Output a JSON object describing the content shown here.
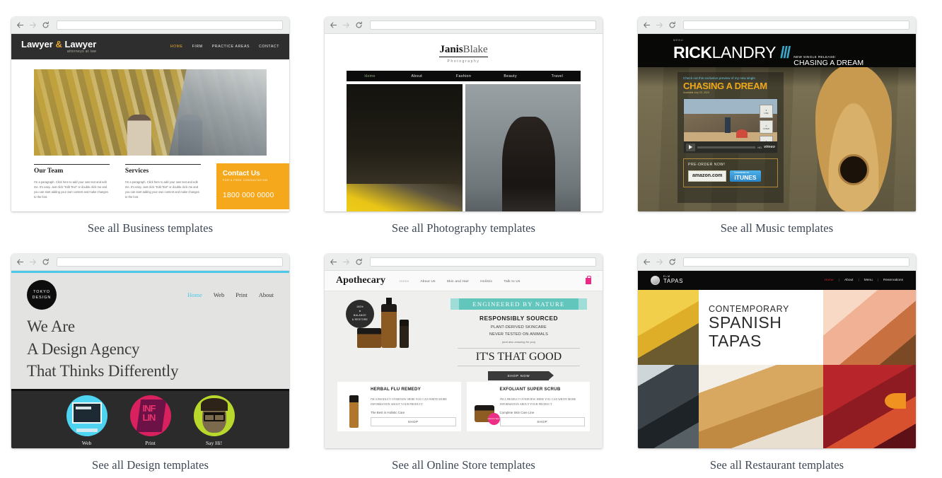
{
  "browser_chrome": {
    "back_icon": "back-arrow-icon",
    "forward_icon": "forward-arrow-icon",
    "reload_icon": "reload-icon",
    "url_value": "",
    "url_placeholder": ""
  },
  "cards": [
    {
      "id": "business",
      "caption": "See all Business templates",
      "site": {
        "logo": "Lawyer",
        "logo_amp": "&",
        "logo_2": "Lawyer",
        "tagline": "attorneys at law",
        "nav": [
          "HOME",
          "FIRM",
          "PRACTICE AREAS",
          "CONTACT"
        ],
        "active_nav": "HOME",
        "col1_title": "Our Team",
        "col1_body": "I'm a paragraph. Click here to add your own text and edit me. It's easy. Just click \"Edit Text\" or double click me and you can start adding your own content and make changes to the font.",
        "col2_title": "Services",
        "col2_body": "I'm a paragraph. Click here to add your own text and edit me. It's easy. Just click \"Edit Text\" or double click me and you can start adding your own content and make changes to the font.",
        "contact_title": "Contact Us",
        "contact_sub": "FOR A FREE CONSULTATION",
        "contact_phone": "1800 000 0000",
        "accent": "#f5a81c"
      }
    },
    {
      "id": "photography",
      "caption": "See all Photography templates",
      "site": {
        "logo_first": "Janis",
        "logo_last": "Blake",
        "tagline": "Photography",
        "nav": [
          "Home",
          "About",
          "Fashion",
          "Beauty",
          "Travel"
        ],
        "active_nav": "Home",
        "accent": "#8fae7a"
      }
    },
    {
      "id": "music",
      "caption": "See all Music templates",
      "site": {
        "menu_label": "MENU",
        "logo_first": "RICK",
        "logo_last": "LANDRY",
        "logo_slashes": "///",
        "release_label": "NEW SINGLE RELEASE:",
        "release_title": "CHASING A DREAM",
        "promo_kicker": "Check out this exclusive preview of my new single",
        "promo_title": "CHASING A DREAM",
        "promo_date": "Available July 23, 2023",
        "video_time": "00:34",
        "video_hd": "HD",
        "video_brand": "vimeo",
        "video_side_buttons": [
          "LIKE",
          "LATER",
          "SHARE"
        ],
        "preorder_label": "PRE-ORDER NOW!",
        "store_amazon": "amazon",
        "store_amazon_tld": ".com",
        "store_itunes_small": "Download on",
        "store_itunes": "iTUNES",
        "accent": "#f0a81b"
      }
    },
    {
      "id": "design",
      "caption": "See all Design templates",
      "site": {
        "logo_l1": "TOKYO",
        "logo_l2": "DESIGN",
        "nav": [
          "Home",
          "Web",
          "Print",
          "About"
        ],
        "active_nav": "Home",
        "headline_1": "We Are",
        "headline_2": "A Design Agency",
        "headline_3": "That Thinks Differently",
        "tiles": [
          {
            "label": "Web",
            "color": "#4ed3f0"
          },
          {
            "label": "Print",
            "color": "#d9215f"
          },
          {
            "label": "Say Hi!",
            "color": "#b8d92b"
          }
        ],
        "accent": "#4ec8e8"
      }
    },
    {
      "id": "skincare",
      "caption": "See all Online Store templates",
      "site": {
        "logo": "Apothecary",
        "nav": [
          "Home",
          "About Us",
          "Skin and Hair",
          "Holistic",
          "Talk to Us"
        ],
        "active_nav": "Home",
        "cart_icon": "shopping-bag-icon",
        "badge_l1": "100%",
        "badge_l2": "BALANCE",
        "badge_l3": "& RESTORE",
        "ribbon": "ENGINEERED BY NATURE",
        "sourced": "RESPONSIBLY SOURCED",
        "sub_1": "PLANT-DERIVED SKINCARE",
        "sub_2": "NEVER TESTED ON ANIMALS",
        "sub_italic": "(and also amazing for you)",
        "headline": "IT'S THAT GOOD",
        "shop_now": "SHOP NOW",
        "products": [
          {
            "title": "HERBAL FLU REMEDY",
            "desc": "I'M A PRODUCT OVERVIEW. HERE YOU CAN WRITE MORE INFORMATION ABOUT YOUR PRODUCT.",
            "tag": "The Best in Holistic Care",
            "button": "SHOP",
            "badge": ""
          },
          {
            "title": "EXFOLIANT SUPER SCRUB",
            "desc": "I'M A PRODUCT OVERVIEW. HERE YOU CAN WRITE MORE INFORMATION ABOUT YOUR PRODUCT.",
            "tag": "Complete Skin Care Line",
            "button": "SHOP",
            "badge": "customer fave!"
          }
        ],
        "accent": "#63c6bd"
      }
    },
    {
      "id": "restaurant",
      "caption": "See all Restaurant templates",
      "site": {
        "logo_l1": "ELM",
        "logo_l2": "TAPAS",
        "nav": [
          "Home",
          "About",
          "Menu",
          "Reservations"
        ],
        "active_nav": "Home",
        "divider": "|",
        "headline_1": "CONTEMPORARY",
        "headline_2": "SPANISH",
        "headline_3": "TAPAS",
        "accent": "#c8262a"
      }
    }
  ]
}
